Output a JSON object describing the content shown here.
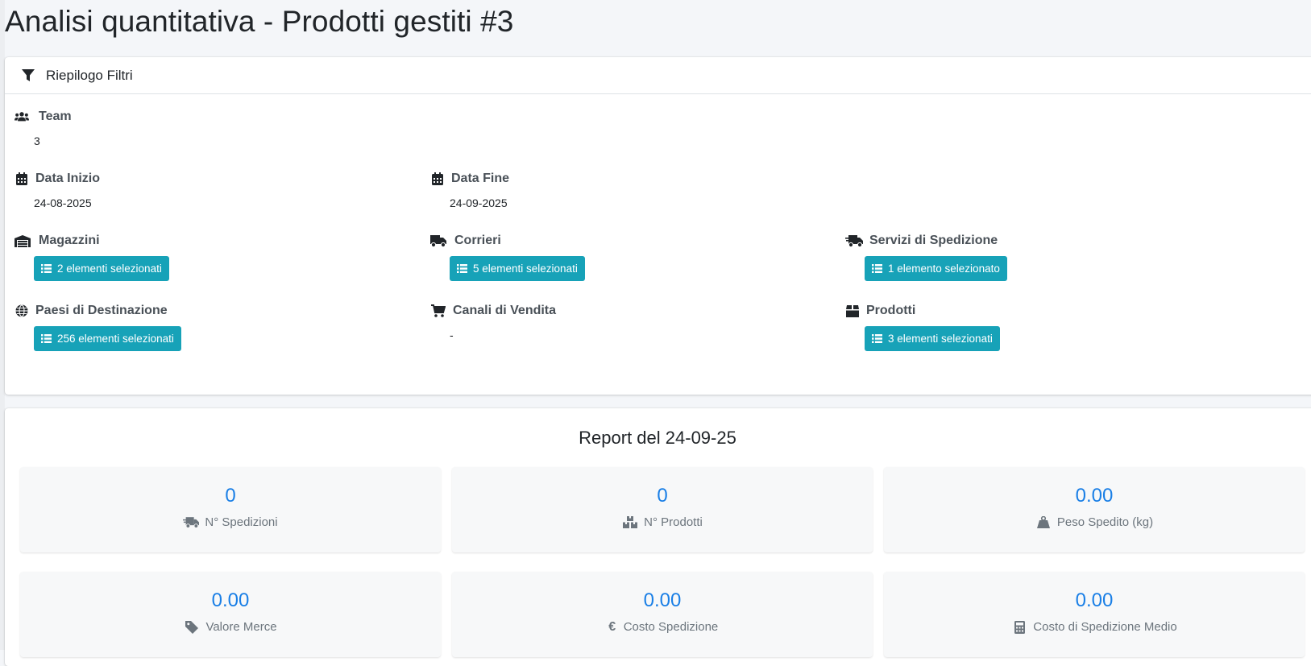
{
  "page": {
    "title": "Analisi quantitativa - Prodotti gestiti #3"
  },
  "filters_card": {
    "header_title": "Riepilogo Filtri",
    "team": {
      "label": "Team",
      "value": "3",
      "icon": "users-icon"
    },
    "data_inizio": {
      "label": "Data Inizio",
      "value": "24-08-2025",
      "icon": "calendar-icon"
    },
    "data_fine": {
      "label": "Data Fine",
      "value": "24-09-2025",
      "icon": "calendar-icon"
    },
    "magazzini": {
      "label": "Magazzini",
      "button": "2 elementi selezionati",
      "icon": "warehouse-icon"
    },
    "corrieri": {
      "label": "Corrieri",
      "button": "5 elementi selezionati",
      "icon": "truck-icon"
    },
    "servizi": {
      "label": "Servizi di Spedizione",
      "button": "1 elemento selezionato",
      "icon": "shipping-fast-icon"
    },
    "paesi": {
      "label": "Paesi di Destinazione",
      "button": "256 elementi selezionati",
      "icon": "globe-icon"
    },
    "canali": {
      "label": "Canali di Vendita",
      "value": "-",
      "icon": "cart-icon"
    },
    "prodotti": {
      "label": "Prodotti",
      "button": "3 elementi selezionati",
      "icon": "box-icon"
    }
  },
  "report": {
    "title": "Report del 24-09-25",
    "stats": [
      {
        "value": "0",
        "label": "N° Spedizioni",
        "icon": "shipping-fast-icon"
      },
      {
        "value": "0",
        "label": "N° Prodotti",
        "icon": "boxes-icon"
      },
      {
        "value": "0.00",
        "label": "Peso Spedito (kg)",
        "icon": "weight-icon"
      },
      {
        "value": "0.00",
        "label": "Valore Merce",
        "icon": "tag-icon"
      },
      {
        "value": "0.00",
        "label": "Costo Spedizione",
        "icon": "euro-icon"
      },
      {
        "value": "0.00",
        "label": "Costo di Spedizione Medio",
        "icon": "calculator-icon"
      }
    ]
  },
  "colors": {
    "accent_button": "#17a2b8",
    "stat_value": "#1a7fe6",
    "background": "#f4f6f9"
  }
}
